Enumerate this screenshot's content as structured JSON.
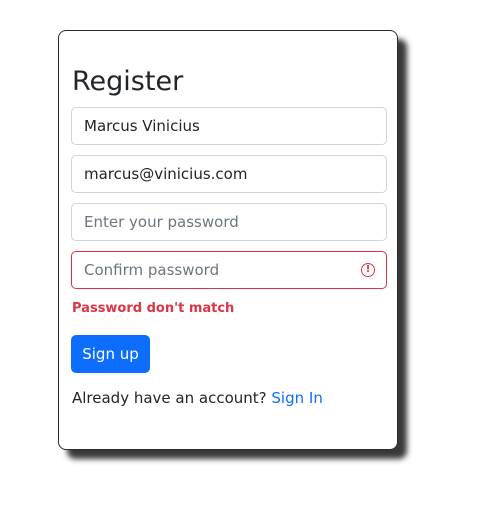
{
  "form": {
    "title": "Register",
    "name": {
      "value": "Marcus Vinicius"
    },
    "email": {
      "value": "marcus@vinicius.com"
    },
    "password": {
      "value": "",
      "placeholder": "Enter your password"
    },
    "confirm_password": {
      "value": "",
      "placeholder": "Confirm password",
      "status_icon": "exclamation-circle-icon"
    },
    "error_message": "Password don't match",
    "submit_label": "Sign up",
    "footer": {
      "prompt": "Already have an account?",
      "link_label": "Sign In"
    }
  },
  "colors": {
    "primary": "#0d6efd",
    "danger": "#dc3545",
    "border": "#ced4da",
    "text": "#212529"
  }
}
